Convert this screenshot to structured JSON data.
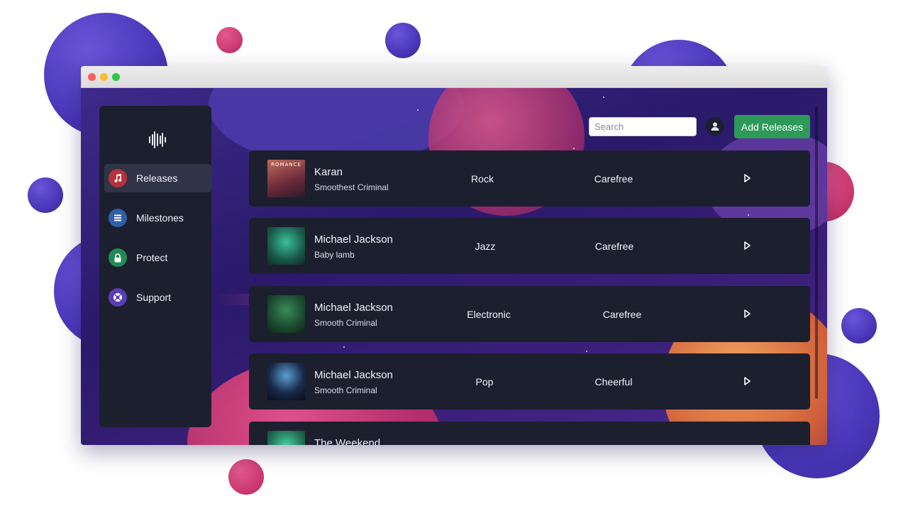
{
  "window": {
    "title": ""
  },
  "sidebar": {
    "logo_icon": "soundwave-icon",
    "items": [
      {
        "label": "Releases",
        "icon": "music-note-icon",
        "color": "#b9313a",
        "active": true
      },
      {
        "label": "Milestones",
        "icon": "list-icon",
        "color": "#2f5fa8",
        "active": false
      },
      {
        "label": "Protect",
        "icon": "lock-icon",
        "color": "#238a55",
        "active": false
      },
      {
        "label": "Support",
        "icon": "lifebuoy-icon",
        "color": "#5a3db0",
        "active": false
      }
    ]
  },
  "header": {
    "search_placeholder": "Search",
    "avatar_icon": "user-icon",
    "add_button_label": "Add Releases"
  },
  "releases": [
    {
      "artist": "Karan",
      "track": "Smoothest Criminal",
      "genre": "Rock",
      "mood": "Carefree",
      "cover_text": "ROMANCE",
      "cover_color": "#8a3a3a"
    },
    {
      "artist": "Michael Jackson",
      "track": "Baby lamb",
      "genre": "Jazz",
      "mood": "Carefree",
      "cover_text": "",
      "cover_color": "#1f5a4a"
    },
    {
      "artist": "Michael Jackson",
      "track": "Smooth Criminal",
      "genre": "Electronic",
      "mood": "Carefree",
      "cover_text": "",
      "cover_color": "#1f4a2e"
    },
    {
      "artist": "Michael Jackson",
      "track": "Smooth Criminal",
      "genre": "Pop",
      "mood": "Cheerful",
      "cover_text": "",
      "cover_color": "#0f1a2e"
    },
    {
      "artist": "The Weekend",
      "track": "",
      "genre": "",
      "mood": "",
      "cover_text": "",
      "cover_color": "#2a7a5a"
    }
  ],
  "colors": {
    "accent_green": "#2e9a5a",
    "panel": "#1c1f2e"
  }
}
